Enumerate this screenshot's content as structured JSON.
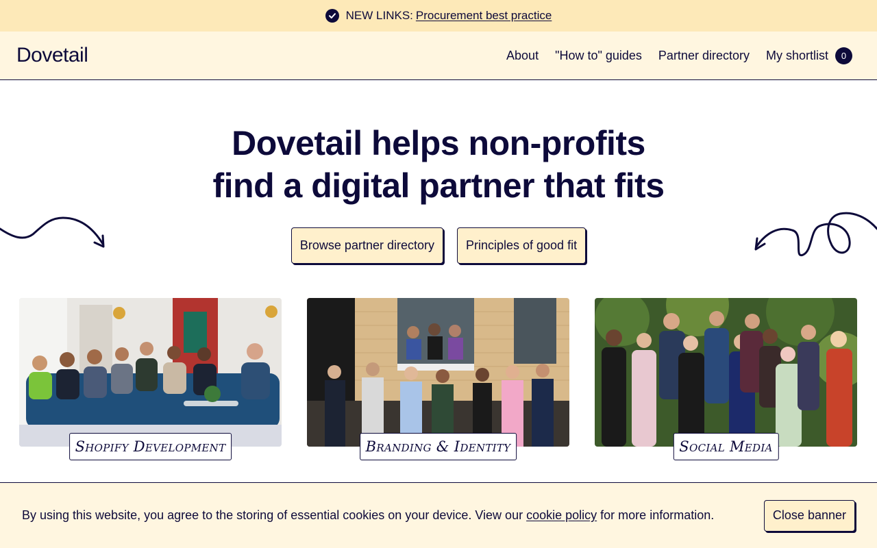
{
  "announcement": {
    "prefix": "NEW LINKS:",
    "link_text": "Procurement best practice",
    "icon": "check-circle-icon"
  },
  "header": {
    "logo": "Dovetail",
    "nav": [
      {
        "label": "About"
      },
      {
        "label": "\"How to\" guides"
      },
      {
        "label": "Partner directory"
      },
      {
        "label": "My shortlist"
      }
    ],
    "shortlist_count": "0"
  },
  "hero": {
    "title_line1": "Dovetail helps non-profits",
    "title_line2": "find a digital partner that fits",
    "cta_primary": "Browse partner directory",
    "cta_secondary": "Principles of good fit"
  },
  "cards": [
    {
      "label": "Shopify Development"
    },
    {
      "label": "Branding & Identity"
    },
    {
      "label": "Social Media"
    }
  ],
  "cookie": {
    "text_before": "By using this website, you agree to the storing of essential cookies on your device. View our",
    "link_text": "cookie policy",
    "text_after": "for more information.",
    "close_label": "Close banner"
  },
  "colors": {
    "brand_navy": "#0d0a3a",
    "announcement_bg": "#fde9b8",
    "header_bg": "#fff6e0",
    "button_bg": "#fff0cc"
  }
}
